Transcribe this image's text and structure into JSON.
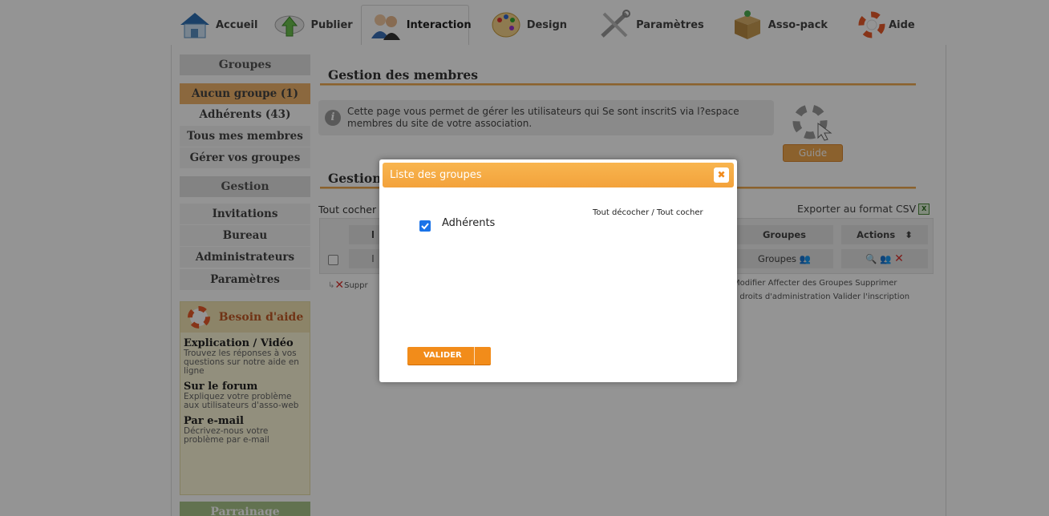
{
  "nav": {
    "tabs": [
      {
        "label": "Accueil",
        "icon": "house-icon"
      },
      {
        "label": "Publier",
        "icon": "cloud-upload-icon"
      },
      {
        "label": "Interaction",
        "icon": "people-icon"
      },
      {
        "label": "Design",
        "icon": "palette-icon"
      },
      {
        "label": "Paramètres",
        "icon": "tools-icon"
      },
      {
        "label": "Asso-pack",
        "icon": "box-icon"
      },
      {
        "label": "Aide",
        "icon": "lifebuoy-icon"
      }
    ],
    "active": "Interaction"
  },
  "sidebar": {
    "groups_header": "Groupes",
    "groups": [
      "Aucun groupe (1)",
      "Adhérents (43)",
      "Tous mes membres",
      "Gérer vos groupes"
    ],
    "gestion_header": "Gestion",
    "gestion": [
      "Invitations",
      "Bureau",
      "Administrateurs",
      "Paramètres"
    ],
    "help": {
      "title": "Besoin d'aide",
      "blocks": [
        {
          "title": "Explication / Vidéo",
          "text": "Trouvez les réponses à vos questions sur notre aide en ligne"
        },
        {
          "title": "Sur le forum",
          "text": "Expliquez votre problème aux utilisateurs d'asso-web"
        },
        {
          "title": "Par e-mail",
          "text": "Décrivez-nous votre problème par e-mail"
        }
      ]
    },
    "parrainage": "Parrainage"
  },
  "main": {
    "title": "Gestion des membres",
    "info": "Cette page vous permet de gérer les utilisateurs qui Se sont inscritS via l?espace membres du site de votre association.",
    "guide_label": "Guide",
    "section2_title": "Gestion",
    "tout_cocher": "Tout cocher /",
    "export_label": "Exporter au format CSV",
    "table": {
      "col_groupes": "Groupes",
      "col_actions": "Actions",
      "sort_glyph": "⬍",
      "cell_prefix": "l",
      "row_groupes": "Groupes"
    },
    "suppr_label": "Suppr",
    "legend1": "Modifier  Affecter des Groupes  Supprimer",
    "legend2": "s droits d'administration  Valider l'inscription"
  },
  "modal": {
    "title": "Liste des groupes",
    "close_glyph": "✖",
    "links": "Tout décocher  /  Tout cocher",
    "items": [
      {
        "label": "Adhérents",
        "checked": true
      }
    ],
    "submit": "VALIDER"
  },
  "colors": {
    "accent": "#f3a23b",
    "checkbox": "#1a73e8",
    "delete": "#d9302b"
  }
}
